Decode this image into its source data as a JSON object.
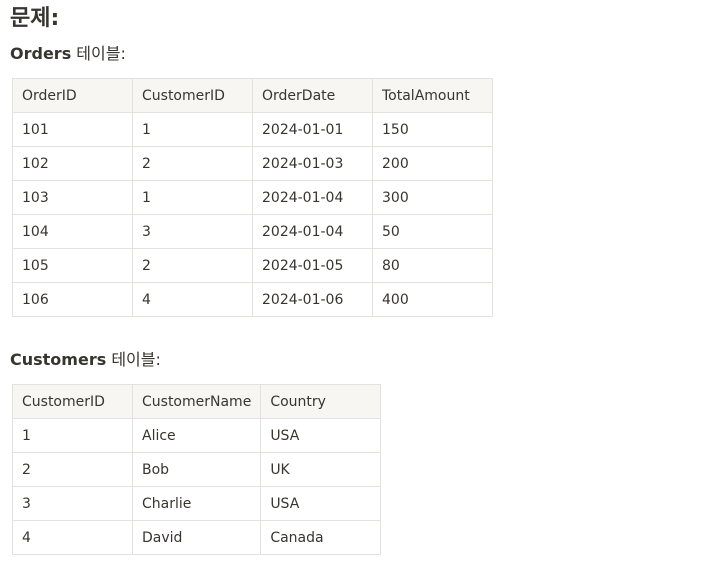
{
  "heading": "문제:",
  "orders": {
    "title_strong": "Orders",
    "title_rest": " 테이블:",
    "columns": [
      "OrderID",
      "CustomerID",
      "OrderDate",
      "TotalAmount"
    ],
    "rows": [
      [
        "101",
        "1",
        "2024-01-01",
        "150"
      ],
      [
        "102",
        "2",
        "2024-01-03",
        "200"
      ],
      [
        "103",
        "1",
        "2024-01-04",
        "300"
      ],
      [
        "104",
        "3",
        "2024-01-04",
        "50"
      ],
      [
        "105",
        "2",
        "2024-01-05",
        "80"
      ],
      [
        "106",
        "4",
        "2024-01-06",
        "400"
      ]
    ]
  },
  "customers": {
    "title_strong": "Customers",
    "title_rest": " 테이블:",
    "columns": [
      "CustomerID",
      "CustomerName",
      "Country"
    ],
    "rows": [
      [
        "1",
        "Alice",
        "USA"
      ],
      [
        "2",
        "Bob",
        "UK"
      ],
      [
        "3",
        "Charlie",
        "USA"
      ],
      [
        "4",
        "David",
        "Canada"
      ]
    ]
  }
}
